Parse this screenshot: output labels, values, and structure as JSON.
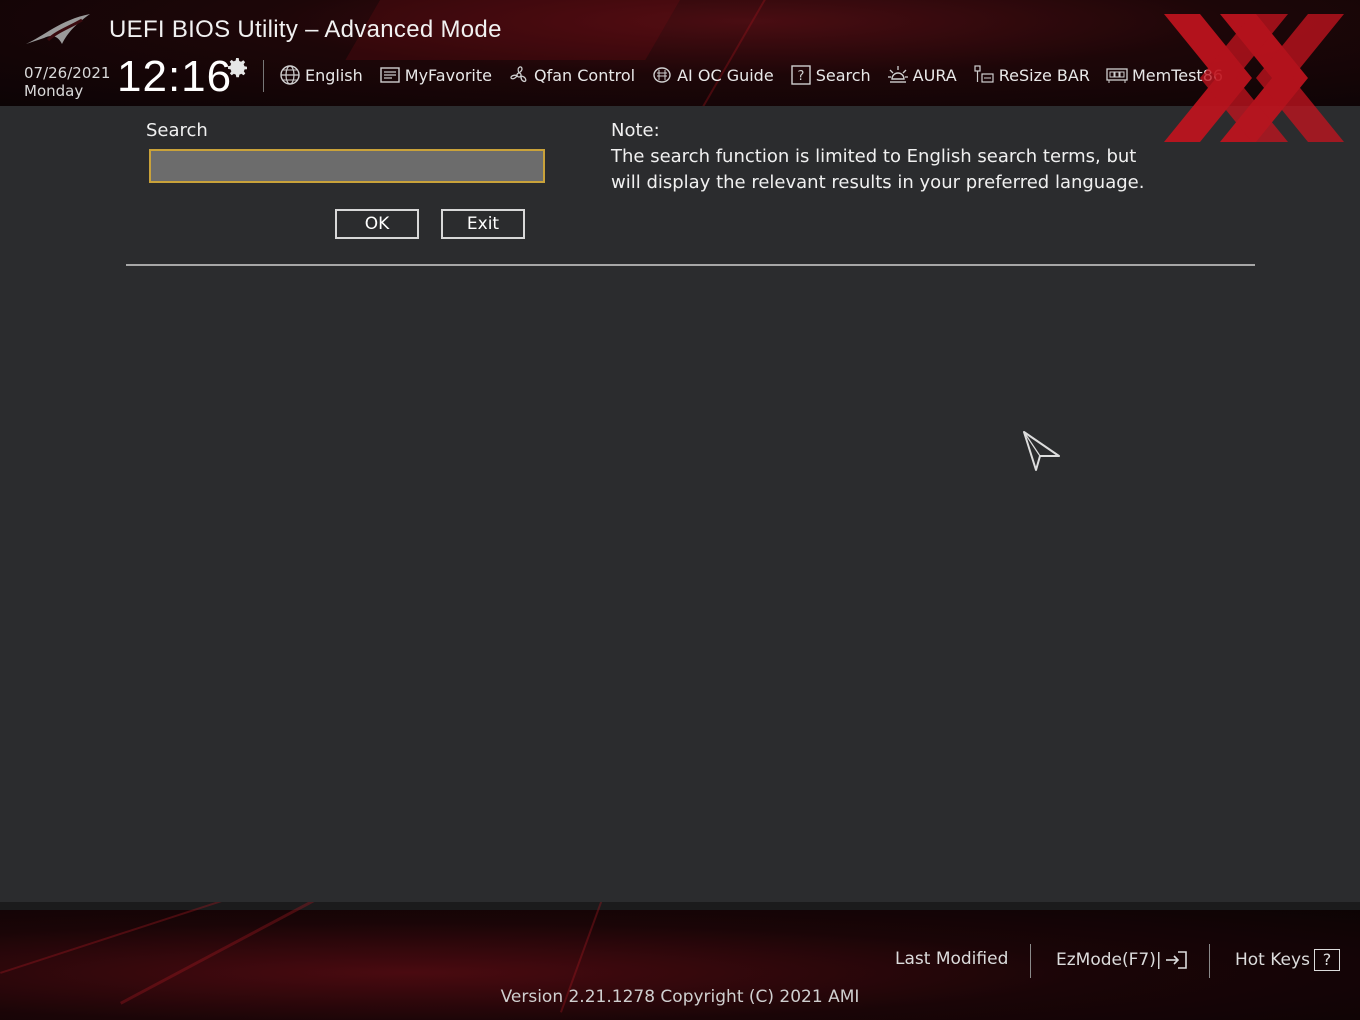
{
  "header": {
    "title": "UEFI BIOS Utility – Advanced Mode",
    "date": "07/26/2021",
    "weekday": "Monday",
    "time": "12:16",
    "menu": [
      {
        "label": "English",
        "icon": "globe-icon"
      },
      {
        "label": "MyFavorite",
        "icon": "favorite-list-icon"
      },
      {
        "label": "Qfan Control",
        "icon": "fan-icon"
      },
      {
        "label": "AI OC Guide",
        "icon": "ai-chip-icon"
      },
      {
        "label": "Search",
        "icon": "question-box-icon"
      },
      {
        "label": "AURA",
        "icon": "aura-light-icon"
      },
      {
        "label": "ReSize BAR",
        "icon": "resize-bar-icon"
      },
      {
        "label": "MemTest86",
        "icon": "memory-icon"
      }
    ]
  },
  "search": {
    "label": "Search",
    "value": "",
    "ok_label": "OK",
    "exit_label": "Exit"
  },
  "note": {
    "title": "Note:",
    "text": "The search function is limited to English search terms, but will display the relevant results in your preferred language."
  },
  "footer": {
    "last_modified": "Last Modified",
    "ezmode": "EzMode(F7)|",
    "hot_keys": "Hot Keys",
    "hot_keys_icon": "?",
    "version": "Version 2.21.1278 Copyright (C) 2021 AMI"
  },
  "colors": {
    "background": "#2b2c2e",
    "header_red": "#4a0d12",
    "input_border": "#c9a23a",
    "input_fill": "#6c6c6c",
    "watermark_red": "#c0141e"
  }
}
